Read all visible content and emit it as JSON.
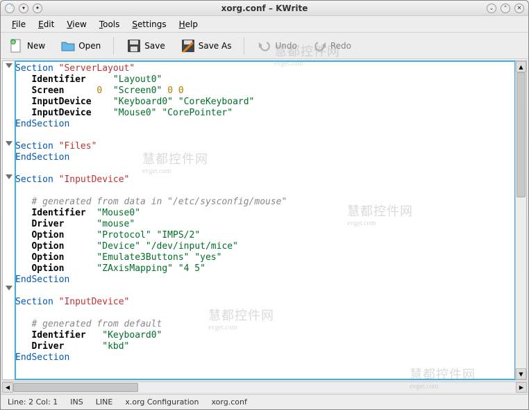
{
  "title": "xorg.conf – KWrite",
  "menu": {
    "file": "File",
    "edit": "Edit",
    "view": "View",
    "tools": "Tools",
    "settings": "Settings",
    "help": "Help"
  },
  "toolbar": {
    "new": "New",
    "open": "Open",
    "save": "Save",
    "saveas": "Save As",
    "undo": "Undo",
    "redo": "Redo"
  },
  "status": {
    "linecol": "Line: 2 Col: 1",
    "ins": "INS",
    "mode": "LINE",
    "syntax": "x.org Configuration",
    "file": "xorg.conf"
  },
  "code": {
    "l1_sec": "Section",
    "l1_str": "\"ServerLayout\"",
    "l2_k": "Identifier",
    "l2_v": "\"Layout0\"",
    "l3_k": "Screen",
    "l3_n1": "0",
    "l3_v": "\"Screen0\"",
    "l3_n2": "0",
    "l3_n3": "0",
    "l4_k": "InputDevice",
    "l4_v1": "\"Keyboard0\"",
    "l4_v2": "\"CoreKeyboard\"",
    "l5_k": "InputDevice",
    "l5_v1": "\"Mouse0\"",
    "l5_v2": "\"CorePointer\"",
    "end": "EndSection",
    "l7_sec": "Section",
    "l7_str": "\"Files\"",
    "l9_sec": "Section",
    "l9_str": "\"InputDevice\"",
    "l10_c": "# generated from data in \"/etc/sysconfig/mouse\"",
    "l11_k": "Identifier",
    "l11_v": "\"Mouse0\"",
    "l12_k": "Driver",
    "l12_v": "\"mouse\"",
    "l13_k": "Option",
    "l13_v1": "\"Protocol\"",
    "l13_v2": "\"IMPS/2\"",
    "l14_k": "Option",
    "l14_v1": "\"Device\"",
    "l14_v2": "\"/dev/input/mice\"",
    "l15_k": "Option",
    "l15_v1": "\"Emulate3Buttons\"",
    "l15_v2": "\"yes\"",
    "l16_k": "Option",
    "l16_v1": "\"ZAxisMapping\"",
    "l16_v2": "\"4 5\"",
    "l18_sec": "Section",
    "l18_str": "\"InputDevice\"",
    "l19_c": "# generated from default",
    "l20_k": "Identifier",
    "l20_v": "\"Keyboard0\"",
    "l21_k": "Driver",
    "l21_v": "\"kbd\""
  },
  "watermark": {
    "cn": "慧都控件网",
    "en": "evget.com"
  }
}
